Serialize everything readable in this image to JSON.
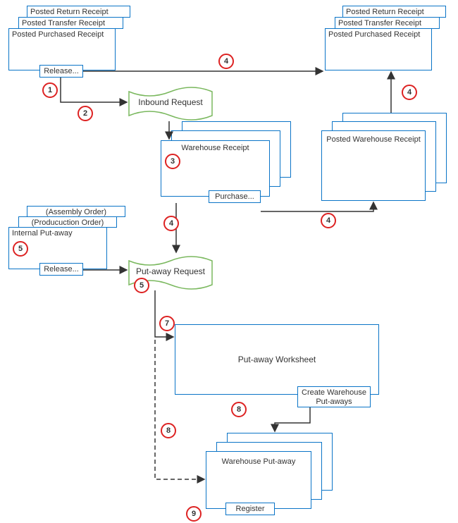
{
  "stacks": {
    "postedSrc": {
      "back": "Posted Return  Receipt",
      "mid": "Posted Transfer Receipt",
      "front": "Posted Purchased Receipt"
    },
    "postedDst": {
      "back": "Posted Return  Receipt",
      "mid": "Posted Transfer Receipt",
      "front": "Posted Purchased Receipt"
    },
    "internal": {
      "back": "(Assembly Order)",
      "mid": "(Producuction Order)",
      "front": "Internal Put-away"
    },
    "whseReceipt": {
      "front": "Warehouse Receipt"
    },
    "postedWhseReceipt": {
      "front": "Posted Warehouse Receipt"
    },
    "whsePutaway": {
      "front": "Warehouse Put-away"
    }
  },
  "green": {
    "inbound": "Inbound Request",
    "putaway": "Put-away Request"
  },
  "buttons": {
    "release1": "Release...",
    "release2": "Release...",
    "purchase": "Purchase...",
    "createPutaways": "Create Warehouse Put-aways",
    "register": "Register"
  },
  "worksheet": "Put-away Worksheet",
  "badges": {
    "b1": "1",
    "b2": "2",
    "b3": "3",
    "b4a": "4",
    "b4b": "4",
    "b4c": "4",
    "b4d": "4",
    "b5a": "5",
    "b5b": "5",
    "b7": "7",
    "b8a": "8",
    "b8b": "8",
    "b9": "9"
  }
}
